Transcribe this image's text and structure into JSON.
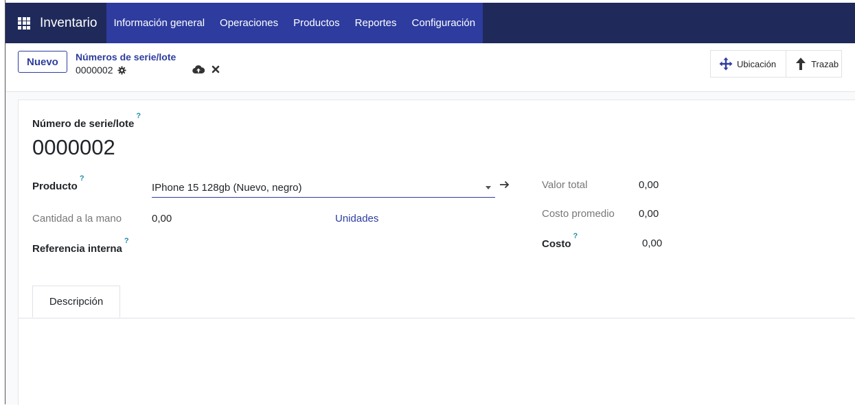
{
  "app": {
    "name": "Inventario",
    "menu": [
      "Información general",
      "Operaciones",
      "Productos",
      "Reportes",
      "Configuración"
    ]
  },
  "control": {
    "new_label": "Nuevo",
    "breadcrumb_parent": "Números de serie/lote",
    "breadcrumb_current": "0000002",
    "stat_buttons": [
      "Ubicación",
      "Trazab"
    ]
  },
  "form": {
    "lot_label": "Número de serie/lote",
    "lot_name": "0000002",
    "product_label": "Producto",
    "product_value": "IPhone 15 128gb (Nuevo, negro)",
    "qty_label": "Cantidad a la mano",
    "qty_value": "0,00",
    "uom_value": "Unidades",
    "ref_label": "Referencia interna",
    "total_value_label": "Valor total",
    "total_value": "0,00",
    "avg_cost_label": "Costo promedio",
    "avg_cost": "0,00",
    "cost_label": "Costo",
    "cost_value": "0,00",
    "help_mark": "?"
  },
  "tabs": [
    "Descripción"
  ],
  "colors": {
    "navbar": "#1f2a5a",
    "menu_active": "#2d3c9e",
    "accent": "#2d3c9e",
    "help": "#1b8ca7"
  }
}
